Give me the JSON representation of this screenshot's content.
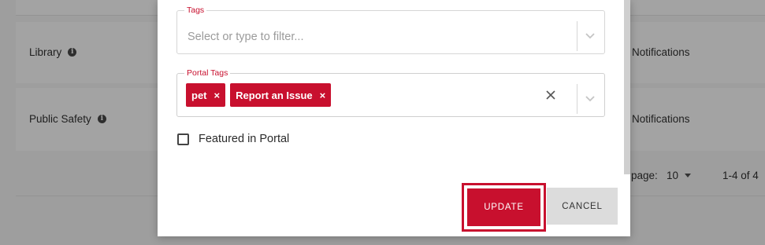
{
  "background": {
    "rows": [
      {
        "label": "Library",
        "notifications": "Notifications"
      },
      {
        "label": "Public Safety",
        "notifications": "Notifications"
      }
    ],
    "pager": {
      "label": "page:",
      "per_page": "10",
      "range": "1-4 of 4"
    }
  },
  "modal": {
    "tags": {
      "legend": "Tags",
      "placeholder": "Select or type to filter..."
    },
    "portal_tags": {
      "legend": "Portal Tags",
      "chips": [
        "pet",
        "Report an Issue"
      ],
      "chip_remove_glyph": "×"
    },
    "featured": {
      "label": "Featured in Portal",
      "checked": false
    },
    "buttons": {
      "update": "UPDATE",
      "cancel": "CANCEL"
    }
  },
  "colors": {
    "accent": "#c8102e",
    "overlay": "#9e9e9e",
    "cancel_bg": "#dcdcdc"
  },
  "icons": [
    "info-icon",
    "chevron-down-icon",
    "close-icon",
    "caret-down-icon"
  ]
}
